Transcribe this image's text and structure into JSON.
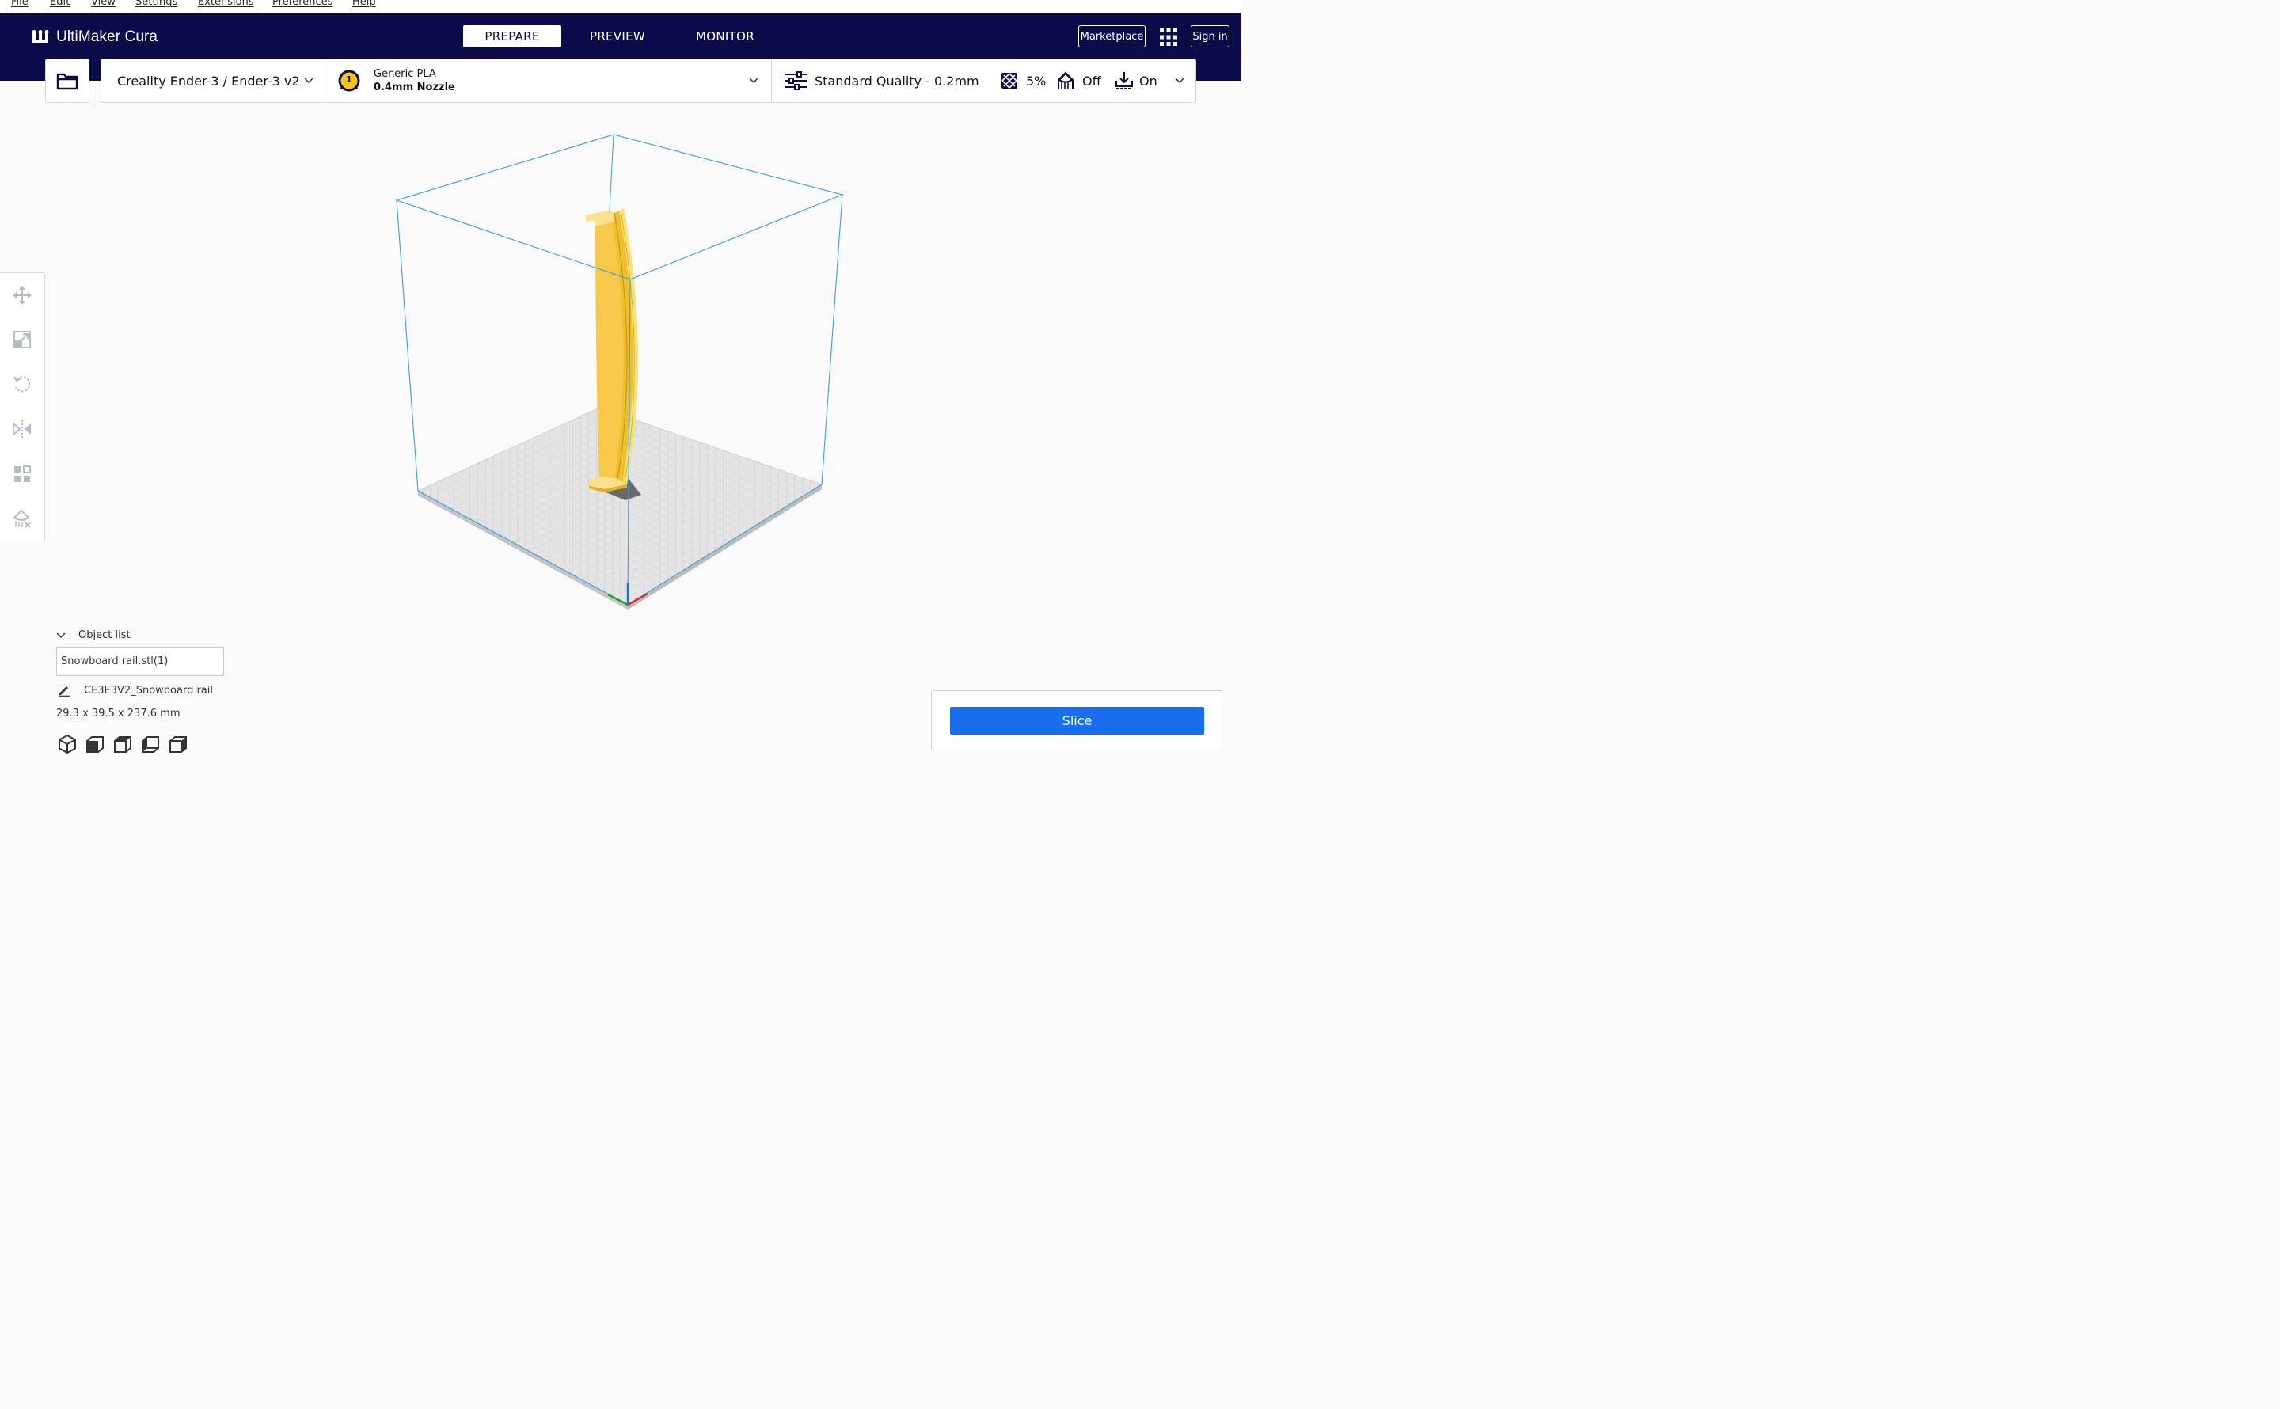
{
  "menu": [
    "File",
    "Edit",
    "View",
    "Settings",
    "Extensions",
    "Preferences",
    "Help"
  ],
  "app": {
    "name": "UltiMaker Cura"
  },
  "stages": {
    "prepare": "PREPARE",
    "preview": "PREVIEW",
    "monitor": "MONITOR",
    "active": "PREPARE"
  },
  "header_buttons": {
    "marketplace": "Marketplace",
    "sign_in": "Sign in"
  },
  "printer": {
    "name": "Creality Ender-3 / Ender-3 v2"
  },
  "material": {
    "extruder_number": "1",
    "name": "Generic PLA",
    "nozzle": "0.4mm Nozzle",
    "color": "#f5c518"
  },
  "print_settings": {
    "quality": "Standard Quality - 0.2mm",
    "infill": "5%",
    "support": "Off",
    "adhesion": "On"
  },
  "left_tools": [
    "move-tool-icon",
    "scale-tool-icon",
    "rotate-tool-icon",
    "mirror-tool-icon",
    "per-model-settings-icon",
    "support-blocker-icon"
  ],
  "object_list": {
    "header": "Object list",
    "items": [
      "Snowboard rail.stl(1)"
    ],
    "job_name": "CE3E3V2_Snowboard rail",
    "dimensions": "29.3 x 39.5 x 237.6 mm"
  },
  "camera_views": [
    "3d-view-icon",
    "front-view-icon",
    "top-view-icon",
    "left-view-icon",
    "right-view-icon"
  ],
  "slice": {
    "label": "Slice"
  },
  "colors": {
    "header_bg": "#0b0b4a",
    "accent": "#196ef0",
    "model": "#f7c84a",
    "build_volume": "#3aa0d8"
  }
}
